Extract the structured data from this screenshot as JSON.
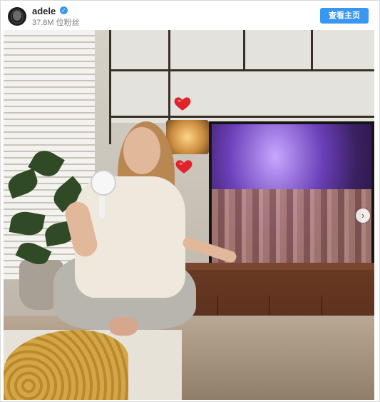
{
  "post": {
    "username": "adele",
    "followers": "37.8M 位粉丝",
    "follow_button": "查看主页"
  },
  "icons": {
    "verified": "verified-badge-icon",
    "next": "chevron-right-icon",
    "heart": "red-heart-icon"
  },
  "colors": {
    "accent": "#3897f0",
    "heart": "#e0242e"
  }
}
